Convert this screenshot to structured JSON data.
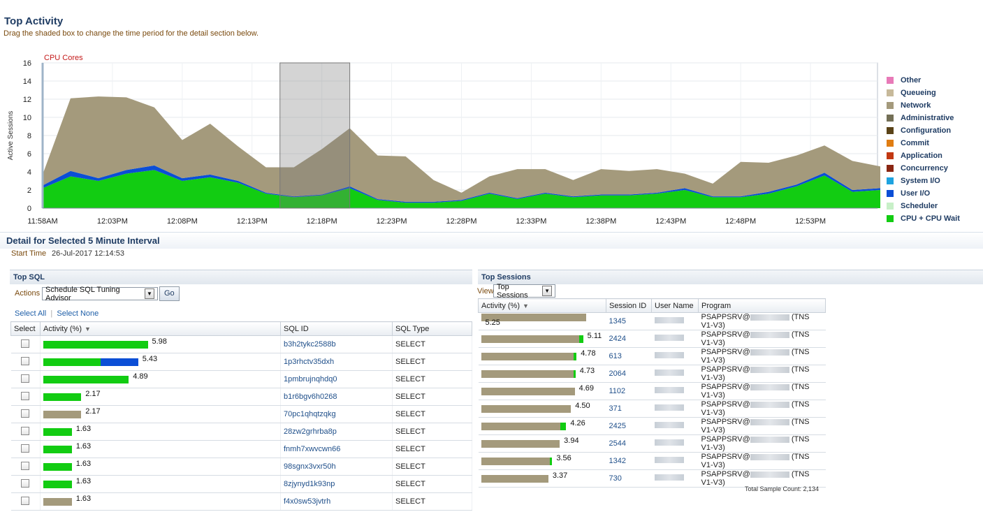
{
  "page": {
    "title": "Top Activity",
    "subtitle": "Drag the shaded box to change the time period for the detail section below."
  },
  "chart_data": {
    "type": "area",
    "stacked": true,
    "unit_label": "CPU Cores",
    "ylabel": "Active Sessions",
    "ylim": [
      0,
      16
    ],
    "yticks": [
      0,
      2,
      4,
      6,
      8,
      10,
      12,
      14,
      16
    ],
    "xlabels": [
      "11:58AM",
      "12:03PM",
      "12:08PM",
      "12:13PM",
      "12:18PM",
      "12:23PM",
      "12:28PM",
      "12:33PM",
      "12:38PM",
      "12:43PM",
      "12:48PM",
      "12:53PM"
    ],
    "x_minutes_from_start": [
      0,
      5,
      10,
      15,
      20,
      25,
      30,
      35,
      40,
      45,
      50,
      55
    ],
    "x_domain_minutes": [
      0,
      59.8
    ],
    "selection_minutes": [
      17,
      22
    ],
    "grid": true,
    "legend_position": "right",
    "legend": [
      {
        "name": "Other",
        "color": "#e87ab8"
      },
      {
        "name": "Queueing",
        "color": "#c7b99a"
      },
      {
        "name": "Network",
        "color": "#a49a7c"
      },
      {
        "name": "Administrative",
        "color": "#736f56"
      },
      {
        "name": "Configuration",
        "color": "#5a4318"
      },
      {
        "name": "Commit",
        "color": "#e07d12"
      },
      {
        "name": "Application",
        "color": "#c23812"
      },
      {
        "name": "Concurrency",
        "color": "#8a2612"
      },
      {
        "name": "System I/O",
        "color": "#1ea3e0"
      },
      {
        "name": "User I/O",
        "color": "#0b4ed6"
      },
      {
        "name": "Scheduler",
        "color": "#c8f0c8"
      },
      {
        "name": "CPU + CPU Wait",
        "color": "#12cc12"
      }
    ],
    "series": [
      {
        "name": "CPU + CPU Wait",
        "color": "#12cc12",
        "x_step_minutes": 2,
        "values": [
          2.2,
          3.5,
          3.0,
          3.8,
          4.2,
          3.0,
          3.4,
          2.8,
          1.6,
          1.2,
          1.4,
          2.2,
          0.9,
          0.6,
          0.6,
          0.8,
          1.6,
          1.0,
          1.6,
          1.2,
          1.4,
          1.4,
          1.6,
          2.0,
          1.2,
          1.2,
          1.6,
          2.4,
          3.6,
          1.8,
          2.0
        ]
      },
      {
        "name": "User I/O",
        "color": "#0b4ed6",
        "x_step_minutes": 2,
        "values": [
          0.3,
          0.6,
          0.3,
          0.4,
          0.5,
          0.3,
          0.3,
          0.2,
          0.1,
          0.1,
          0.1,
          0.2,
          0.1,
          0.1,
          0.1,
          0.1,
          0.1,
          0.1,
          0.1,
          0.1,
          0.1,
          0.1,
          0.1,
          0.2,
          0.1,
          0.1,
          0.2,
          0.2,
          0.3,
          0.2,
          0.2
        ]
      },
      {
        "name": "Network",
        "color": "#a49a7c",
        "x_step_minutes": 2,
        "values": [
          1.2,
          8.0,
          9.0,
          8.0,
          6.4,
          4.2,
          5.6,
          3.8,
          2.8,
          3.2,
          5.0,
          6.4,
          4.8,
          5.0,
          2.4,
          0.8,
          1.8,
          3.2,
          2.6,
          1.8,
          2.8,
          2.6,
          2.6,
          1.6,
          1.4,
          3.8,
          3.2,
          3.2,
          3.0,
          3.2,
          2.4
        ]
      }
    ]
  },
  "detail": {
    "title": "Detail for Selected 5 Minute Interval",
    "start_label": "Start Time",
    "start_value": "26-Jul-2017 12:14:53"
  },
  "top_sql": {
    "title": "Top SQL",
    "actions_label": "Actions",
    "action_selected": "Schedule SQL Tuning Advisor",
    "go_label": "Go",
    "select_all": "Select All",
    "select_none": "Select None",
    "columns": {
      "select": "Select",
      "activity": "Activity (%)",
      "sql_id": "SQL ID",
      "sql_type": "SQL Type"
    },
    "rows": [
      {
        "value": "5.98",
        "pct": 5.98,
        "cpu": 5.98,
        "io": 0,
        "other": 0,
        "sql_id": "b3h2tykc2588b",
        "sql_type": "SELECT"
      },
      {
        "value": "5.43",
        "pct": 5.43,
        "cpu": 3.26,
        "io": 2.17,
        "other": 0,
        "sql_id": "1p3rhctv35dxh",
        "sql_type": "SELECT"
      },
      {
        "value": "4.89",
        "pct": 4.89,
        "cpu": 4.89,
        "io": 0,
        "other": 0,
        "sql_id": "1pmbrujnqhdq0",
        "sql_type": "SELECT"
      },
      {
        "value": "2.17",
        "pct": 2.17,
        "cpu": 2.17,
        "io": 0,
        "other": 0,
        "sql_id": "b1r6bgv6h0268",
        "sql_type": "SELECT"
      },
      {
        "value": "2.17",
        "pct": 2.17,
        "cpu": 0,
        "io": 0,
        "other": 2.17,
        "sql_id": "70pc1qhqtzqkg",
        "sql_type": "SELECT"
      },
      {
        "value": "1.63",
        "pct": 1.63,
        "cpu": 1.63,
        "io": 0,
        "other": 0,
        "sql_id": "28zw2grhrba8p",
        "sql_type": "SELECT"
      },
      {
        "value": "1.63",
        "pct": 1.63,
        "cpu": 1.63,
        "io": 0,
        "other": 0,
        "sql_id": "fnmh7xwvcwn66",
        "sql_type": "SELECT"
      },
      {
        "value": "1.63",
        "pct": 1.63,
        "cpu": 1.63,
        "io": 0,
        "other": 0,
        "sql_id": "98sgnx3vxr50h",
        "sql_type": "SELECT"
      },
      {
        "value": "1.63",
        "pct": 1.63,
        "cpu": 1.63,
        "io": 0,
        "other": 0,
        "sql_id": "8zjynyd1k93np",
        "sql_type": "SELECT"
      },
      {
        "value": "1.63",
        "pct": 1.63,
        "cpu": 0,
        "io": 0,
        "other": 1.63,
        "sql_id": "f4x0sw53jvtrh",
        "sql_type": "SELECT"
      }
    ]
  },
  "top_sessions": {
    "title": "Top Sessions",
    "view_label": "View",
    "view_selected": "Top Sessions",
    "columns": {
      "activity": "Activity (%)",
      "session_id": "Session ID",
      "user_name": "User Name",
      "program": "Program"
    },
    "rows": [
      {
        "value": "5.25",
        "pct": 5.25,
        "cpu": 0,
        "session_id": "1345",
        "program_prefix": "PSAPPSRV@",
        "program_suffix": "(TNS V1-V3)"
      },
      {
        "value": "5.11",
        "pct": 5.11,
        "cpu": 0.2,
        "session_id": "2424",
        "program_prefix": "PSAPPSRV@",
        "program_suffix": "(TNS V1-V3)"
      },
      {
        "value": "4.78",
        "pct": 4.78,
        "cpu": 0.15,
        "session_id": "613",
        "program_prefix": "PSAPPSRV@",
        "program_suffix": "(TNS V1-V3)"
      },
      {
        "value": "4.73",
        "pct": 4.73,
        "cpu": 0.1,
        "session_id": "2064",
        "program_prefix": "PSAPPSRV@",
        "program_suffix": "(TNS V1-V3)"
      },
      {
        "value": "4.69",
        "pct": 4.69,
        "cpu": 0,
        "session_id": "1102",
        "program_prefix": "PSAPPSRV@",
        "program_suffix": "(TNS V1-V3)"
      },
      {
        "value": "4.50",
        "pct": 4.5,
        "cpu": 0,
        "session_id": "371",
        "program_prefix": "PSAPPSRV@",
        "program_suffix": "(TNS V1-V3)"
      },
      {
        "value": "4.26",
        "pct": 4.26,
        "cpu": 0.3,
        "session_id": "2425",
        "program_prefix": "PSAPPSRV@",
        "program_suffix": "(TNS V1-V3)"
      },
      {
        "value": "3.94",
        "pct": 3.94,
        "cpu": 0,
        "session_id": "2544",
        "program_prefix": "PSAPPSRV@",
        "program_suffix": "(TNS V1-V3)"
      },
      {
        "value": "3.56",
        "pct": 3.56,
        "cpu": 0.1,
        "session_id": "1342",
        "program_prefix": "PSAPPSRV@",
        "program_suffix": "(TNS V1-V3)"
      },
      {
        "value": "3.37",
        "pct": 3.37,
        "cpu": 0,
        "session_id": "730",
        "program_prefix": "PSAPPSRV@",
        "program_suffix": "(TNS V1-V3)"
      }
    ],
    "total_label": "Total Sample Count: 2,134"
  }
}
